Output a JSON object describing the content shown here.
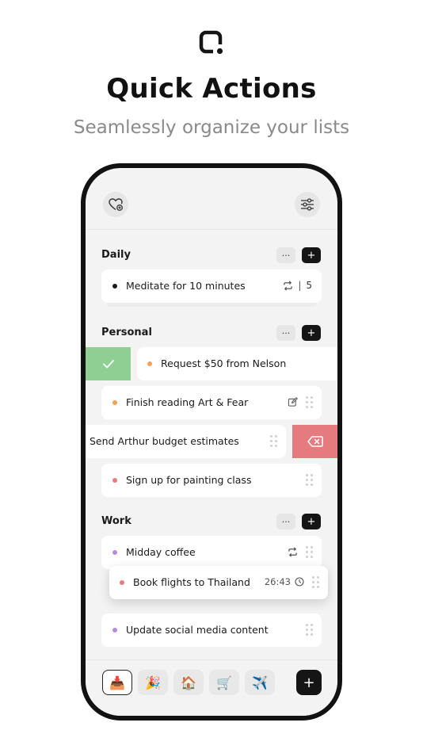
{
  "hero": {
    "title": "Quick Actions",
    "subtitle": "Seamlessly organize your lists",
    "logo_icon": "rounded-square-logo"
  },
  "header": {
    "left_icon": "heart-plus-icon",
    "right_icon": "sliders-icon"
  },
  "sections": [
    {
      "title": "Daily",
      "more_label": "···",
      "add_label": "+",
      "tasks": [
        {
          "text": "Meditate for 10 minutes",
          "dot_color": "#1a1a1a",
          "repeat_count": "5",
          "separator": "|",
          "icons": [
            "repeat-icon"
          ]
        }
      ]
    },
    {
      "title": "Personal",
      "more_label": "···",
      "add_label": "+",
      "tasks": [
        {
          "text": "Request $50 from Nelson",
          "dot_color": "#f0a155",
          "swipe": "complete"
        },
        {
          "text": "Finish reading Art & Fear",
          "dot_color": "#f0a155",
          "icons": [
            "edit-icon",
            "drag-handle-icon"
          ]
        },
        {
          "text": "Send Arthur budget estimates",
          "swipe": "delete",
          "icons": [
            "drag-handle-icon"
          ]
        },
        {
          "text": "Sign up for painting class",
          "dot_color": "#e57b7f",
          "icons": [
            "drag-handle-icon"
          ]
        }
      ]
    },
    {
      "title": "Work",
      "more_label": "···",
      "add_label": "+",
      "tasks": [
        {
          "text": "Midday coffee",
          "dot_color": "#b88ae0",
          "icons": [
            "repeat-icon",
            "drag-handle-icon"
          ]
        },
        {
          "text": "Book flights to Thailand",
          "dot_color": "#e57b7f",
          "timer": "26:43",
          "dragging": true,
          "icons": [
            "clock-icon",
            "drag-handle-icon"
          ]
        },
        {
          "text": "Update social media content",
          "dot_color": "#b88ae0",
          "icons": [
            "drag-handle-icon"
          ]
        }
      ]
    }
  ],
  "swipe_actions": {
    "complete_color": "#8fcf93",
    "delete_color": "#e57b7f",
    "complete_icon": "checkmark-icon",
    "delete_icon": "backspace-icon"
  },
  "tabbar": {
    "tabs": [
      {
        "emoji": "📥",
        "name": "inbox-tab",
        "active": true
      },
      {
        "emoji": "🎉",
        "name": "party-tab",
        "active": false
      },
      {
        "emoji": "🏠",
        "name": "home-tab",
        "active": false
      },
      {
        "emoji": "🛒",
        "name": "cart-tab",
        "active": false
      },
      {
        "emoji": "✈️",
        "name": "travel-tab",
        "active": false
      }
    ],
    "add_label": "+"
  }
}
